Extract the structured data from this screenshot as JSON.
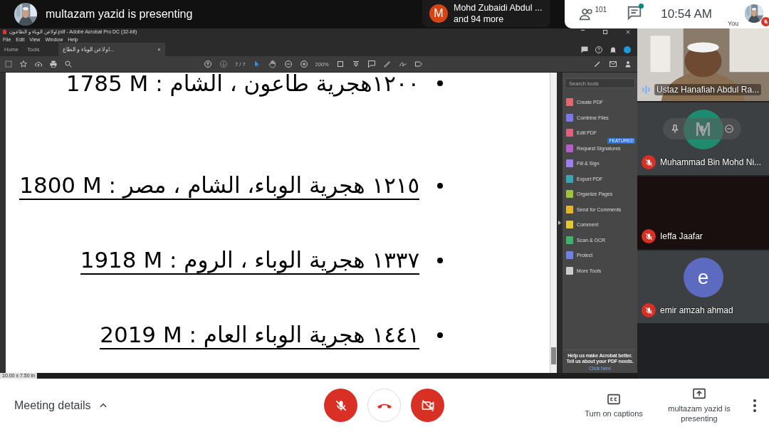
{
  "topbar": {
    "presenter": "multazam yazid is presenting",
    "notification": {
      "initial": "M",
      "name": "Mohd Zubaidi Abdul ...",
      "more": "and 94 more"
    },
    "participant_count": "101",
    "chat_unread": true,
    "time": "10:54 AM",
    "self_label": "You",
    "self_muted": true
  },
  "acrobat": {
    "title": "اولاعن الوباء و الطاعون.pdf - Adobe Acrobat Pro DC (32-bit)",
    "menu": [
      "File",
      "Edit",
      "View",
      "Window",
      "Help"
    ],
    "tabs": [
      {
        "label": "Home",
        "selected": false
      },
      {
        "label": "Tools",
        "selected": false
      },
      {
        "label": "اولاعن الوباء و الطاع...",
        "selected": true,
        "close": "×"
      }
    ],
    "page_indicator": "7 / 7",
    "zoom": "200%",
    "slide_lines": [
      {
        "text": "1785 M : ١٢٠٠هجرية طاعون ، الشام",
        "underlined": false
      },
      {
        "text": "1800 M : ١٢١٥ هجرية الوباء، الشام ، مصر",
        "underlined": true
      },
      {
        "text": "1918 M : ١٣٣٧ هجرية الوباء ، الروم",
        "underlined": true
      },
      {
        "text": "2019 M : ١٤٤١ هجرية الوباء العام",
        "underlined": true
      }
    ],
    "tools_search": {
      "placeholder": "Search tools"
    },
    "tools": [
      {
        "label": "Create PDF",
        "color": "#e0686a"
      },
      {
        "label": "Combine Files",
        "color": "#7a78e6"
      },
      {
        "label": "Edit PDF",
        "color": "#e0607e"
      },
      {
        "label": "Request Signatures",
        "color": "#b45cc8",
        "badge": "FEATURED"
      },
      {
        "label": "Fill & Sign",
        "color": "#9a80e8"
      },
      {
        "label": "Export PDF",
        "color": "#36a6b8"
      },
      {
        "label": "Organize Pages",
        "color": "#9cc43c"
      },
      {
        "label": "Send for Comments",
        "color": "#e6b42a"
      },
      {
        "label": "Comment",
        "color": "#e8c832"
      },
      {
        "label": "Scan & OCR",
        "color": "#3cb46a"
      },
      {
        "label": "Protect",
        "color": "#7280e6"
      },
      {
        "label": "More Tools",
        "color": "#cccccc"
      }
    ],
    "feedback": {
      "text": "Help us make Acrobat better. Tell us about your PDF needs.",
      "link": "Click here"
    },
    "page_size": "10.00 x 7.50 in"
  },
  "participants": [
    {
      "name": "Ustaz Hanafiah Abdul Ra...",
      "kind": "video",
      "muted": false,
      "hovered": false
    },
    {
      "name": "Muhammad Bin Mohd Ni...",
      "kind": "avatar",
      "initial": "M",
      "color": "#1e8a6e",
      "muted": true,
      "hovered": true
    },
    {
      "name": "Ieffa Jaafar",
      "kind": "dark",
      "muted": true,
      "hovered": false
    },
    {
      "name": "emir amzah ahmad",
      "kind": "avatar",
      "initial": "e",
      "color": "#5c6bc0",
      "muted": true,
      "hovered": false
    }
  ],
  "bottombar": {
    "meeting_details": "Meeting details",
    "mic_on": false,
    "camera_on": false,
    "captions": "Turn on captions",
    "presenting": "multazam yazid is presenting"
  }
}
